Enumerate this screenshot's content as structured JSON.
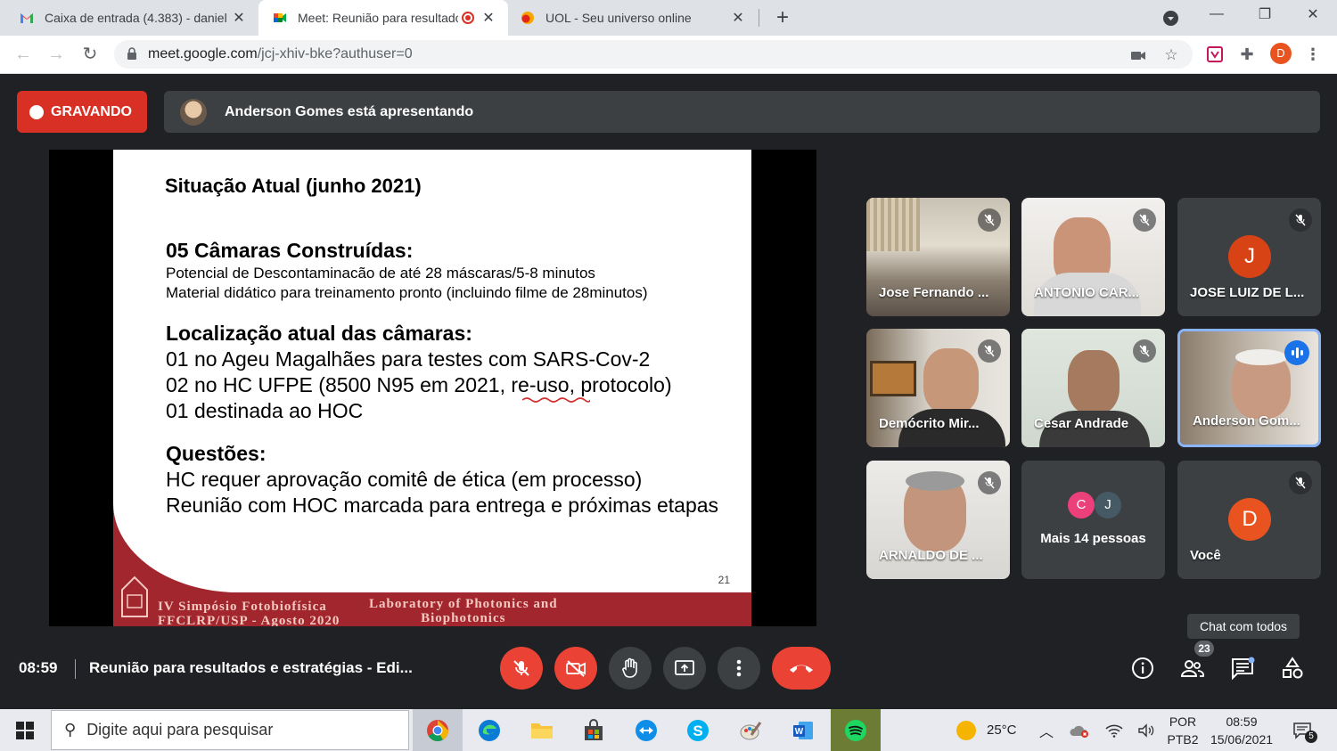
{
  "browser": {
    "tabs": [
      {
        "title": "Caixa de entrada (4.383) - daniel",
        "icon": "gmail-icon"
      },
      {
        "title": "Meet: Reunião para resultado",
        "icon": "meet-icon",
        "recording": true
      },
      {
        "title": "UOL - Seu universo online",
        "icon": "uol-icon"
      }
    ],
    "url_host": "meet.google.com",
    "url_path": "/jcj-xhiv-bke?authuser=0",
    "profile_initial": "D"
  },
  "meet": {
    "recording_label": "GRAVANDO",
    "presenter_text": "Anderson Gomes está apresentando",
    "slide": {
      "title": "Situação Atual (junho 2021)",
      "section1_heading": "05 Câmaras Construídas:",
      "section1_lines": [
        "Potencial de Descontaminacão de até 28 máscaras/5-8 minutos",
        "Material didático para treinamento pronto (incluindo filme de 28minutos)"
      ],
      "section2_heading": "Localização atual das câmaras:",
      "section2_lines": [
        "01 no Ageu Magalhães para testes com SARS-Cov-2",
        "02 no HC UFPE (8500 N95 em 2021, re-uso, protocolo)",
        "01 destinada ao HOC"
      ],
      "section3_heading": "Questões:",
      "section3_lines": [
        "HC requer aprovação comitê de ética (em processo)",
        "Reunião com HOC marcada para entrega e próximas etapas"
      ],
      "page_number": "21",
      "footer_left_1": "IV Simpósio Fotobiofísica",
      "footer_left_2": "FFCLRP/USP - Agosto 2020",
      "footer_right_1": "Laboratory of Photonics and",
      "footer_right_2": "Biophotonics"
    },
    "participants": [
      {
        "name": "Jose Fernando ...",
        "muted": true,
        "video": true
      },
      {
        "name": "ANTONIO CAR...",
        "muted": true,
        "video": true
      },
      {
        "name": "JOSE LUIZ DE L...",
        "muted": true,
        "video": false,
        "initial": "J",
        "color": "#d84315"
      },
      {
        "name": "Demócrito Mir...",
        "muted": true,
        "video": true
      },
      {
        "name": "Cesar Andrade",
        "muted": true,
        "video": true
      },
      {
        "name": "Anderson Gom...",
        "muted": false,
        "speaking": true,
        "video": true
      },
      {
        "name": "ARNALDO DE ...",
        "muted": true,
        "video": true
      },
      {
        "name": "Mais 14 pessoas",
        "more": true,
        "initials": [
          "C",
          "J"
        ],
        "colors": [
          "#ec407a",
          "#455a64"
        ]
      },
      {
        "name": "Você",
        "muted": true,
        "video": false,
        "initial": "D",
        "color": "#e8531f"
      }
    ],
    "controls": {
      "time": "08:59",
      "meeting_title": "Reunião para resultados e estratégias - Edi...",
      "people_count": "23",
      "tooltip": "Chat com todos"
    }
  },
  "taskbar": {
    "search_placeholder": "Digite aqui para pesquisar",
    "temperature": "25°C",
    "lang": "POR",
    "layout": "PTB2",
    "time": "08:59",
    "date": "15/06/2021",
    "notifications": "5"
  }
}
